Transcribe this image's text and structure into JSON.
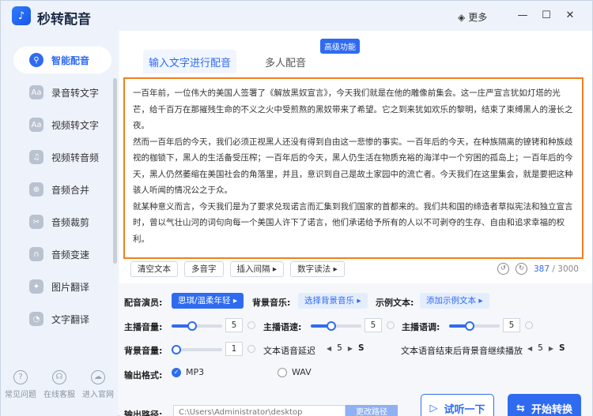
{
  "app": {
    "title": "秒转配音",
    "more_label": "更多"
  },
  "sidebar": {
    "items": [
      {
        "label": "智能配音",
        "active": true
      },
      {
        "label": "录音转文字",
        "active": false
      },
      {
        "label": "视频转文字",
        "active": false
      },
      {
        "label": "视频转音频",
        "active": false
      },
      {
        "label": "音频合并",
        "active": false
      },
      {
        "label": "音频裁剪",
        "active": false
      },
      {
        "label": "音频变速",
        "active": false
      },
      {
        "label": "图片翻译",
        "active": false
      },
      {
        "label": "文字翻译",
        "active": false
      }
    ],
    "bottom": [
      "常见问题",
      "在线客服",
      "进入官网"
    ]
  },
  "tabs": {
    "active": "输入文字进行配音",
    "inactive": "多人配音",
    "badge": "高级功能"
  },
  "editor": {
    "paragraphs": [
      "一百年前，一位伟大的美国人签署了《解放黑奴宣言》，今天我们就是在他的雕像前集会。这一庄严宣言犹如灯塔的光芒，给千百万在那摧残生命的不义之火中受煎熬的黑奴带来了希望。它之到来犹如欢乐的黎明，结束了束缚黑人的漫长之夜。",
      "然而一百年后的今天，我们必须正视黑人还没有得到自由这一悲惨的事实。一百年后的今天，在种族隔离的镣铐和种族歧视的枷锁下，黑人的生活备受压榨；一百年后的今天，黑人仍生活在物质充裕的海洋中一个穷困的孤岛上；一百年后的今天，黑人仍然萎缩在美国社会的角落里，并且，意识到自己是故土家园中的流亡者。今天我们在这里集会，就是要把这种骇人听闻的情况公之于众。",
      "就某种意义而言，今天我们是为了要求兑现诺言而汇集到我们国家的首都来的。我们共和国的缔造者草拟宪法和独立宣言时，曾以气壮山河的词句向每一个美国人许下了诺言，他们承诺给予所有的人以不可剥夺的生存、自由和追求幸福的权利。"
    ],
    "tools": [
      "清空文本",
      "多音字",
      "插入间隔 ▸",
      "数字读法 ▸"
    ],
    "count": "387",
    "max": "/ 3000"
  },
  "settings": {
    "voice_label": "配音演员:",
    "voice_value": "思琪/温柔年轻 ▸",
    "bgm_label": "背景音乐:",
    "bgm_value": "选择背景音乐 ▸",
    "sample_label": "示例文本:",
    "sample_value": "添加示例文本 ▸",
    "volume_label": "主播音量:",
    "volume_value": "5",
    "speed_label": "主播语速:",
    "speed_value": "5",
    "pitch_label": "主播语调:",
    "pitch_value": "5",
    "bg_volume_label": "背景音量:",
    "bg_volume_value": "1",
    "delay_label": "文本语音延迟",
    "delay_value": "5",
    "delay_unit": "S",
    "continue_label": "文本语音结束后背景音继续播放",
    "continue_value": "5",
    "continue_unit": "S",
    "format_label": "输出格式:",
    "format_options": [
      "MP3",
      "WAV"
    ],
    "path_label": "输出路径:",
    "path_value": "C:\\Users\\Administrator\\desktop",
    "path_button": "更改路径",
    "listen_button": "试听一下",
    "start_button": "开始转换"
  },
  "colors": {
    "accent": "#2f6bf0",
    "highlight_border": "#f07f1c"
  }
}
